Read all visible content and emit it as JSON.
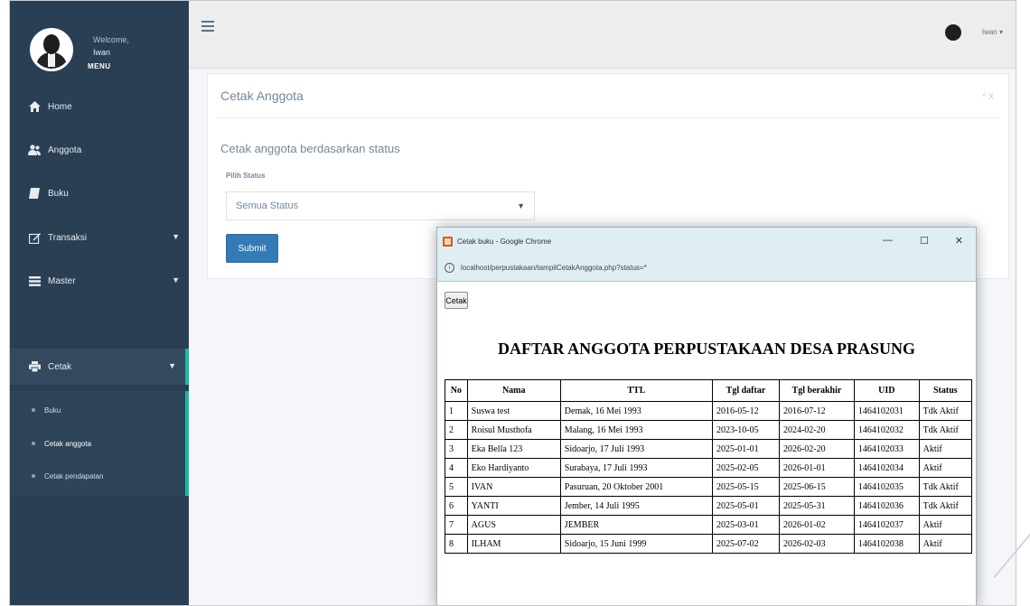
{
  "sidebar": {
    "welcome": "Welcome,",
    "username": "Iwan",
    "menu_title": "MENU",
    "nav": [
      {
        "label": "Home",
        "icon": "home-icon"
      },
      {
        "label": "Anggota",
        "icon": "users-icon"
      },
      {
        "label": "Buku",
        "icon": "book-icon"
      },
      {
        "label": "Transaksi",
        "icon": "edit-icon"
      },
      {
        "label": "Master",
        "icon": "list-icon"
      },
      {
        "label": "Cetak",
        "icon": "print-icon"
      }
    ],
    "sub": [
      "Buku",
      "Cetak anggota",
      "Cetak pendapatan"
    ]
  },
  "topbar": {
    "user": "Iwan"
  },
  "panel": {
    "title": "Cetak Anggota",
    "tools": "^ X",
    "subtitle": "Cetak anggota berdasarkan status",
    "field_label": "Pilih Status",
    "select_value": "Semua Status",
    "submit_label": "Submit"
  },
  "popup": {
    "window_title": "Cetak buku - Google Chrome",
    "url": "localhost/perpustakaan/tampilCetakAnggota.php?status=*",
    "print_button": "Cetak",
    "report_title": "DAFTAR ANGGOTA PERPUSTAKAAN DESA PRASUNG",
    "columns": [
      "No",
      "Nama",
      "TTL",
      "Tgl daftar",
      "Tgl berakhir",
      "UID",
      "Status"
    ],
    "rows": [
      [
        "1",
        "Suswa test",
        "Demak, 16 Mei 1993",
        "2016-05-12",
        "2016-07-12",
        "1464102031",
        "Tdk Aktif"
      ],
      [
        "2",
        "Roisul Musthofa",
        "Malang, 16 Mei 1993",
        "2023-10-05",
        "2024-02-20",
        "1464102032",
        "Tdk Aktif"
      ],
      [
        "3",
        "Eka Bella 123",
        "Sidoarjo, 17 Juli 1993",
        "2025-01-01",
        "2026-02-20",
        "1464102033",
        "Aktif"
      ],
      [
        "4",
        "Eko Hardiyanto",
        "Surabaya, 17 Juli 1993",
        "2025-02-05",
        "2026-01-01",
        "1464102034",
        "Aktif"
      ],
      [
        "5",
        "IVAN",
        "Pasuruan, 20 Oktober 2001",
        "2025-05-15",
        "2025-06-15",
        "1464102035",
        "Tdk Aktif"
      ],
      [
        "6",
        "YANTI",
        "Jember, 14 Juli 1995",
        "2025-05-01",
        "2025-05-31",
        "1464102036",
        "Tdk Aktif"
      ],
      [
        "7",
        "AGUS",
        "JEMBER",
        "2025-03-01",
        "2026-01-02",
        "1464102037",
        "Aktif"
      ],
      [
        "8",
        "ILHAM",
        "Sidoarjo, 15 Juni 1999",
        "2025-07-02",
        "2026-02-03",
        "1464102038",
        "Aktif"
      ]
    ]
  },
  "colors": {
    "sidebar_bg": "#2a3f54",
    "accent": "#1abb9c",
    "button_primary": "#337ab7",
    "popup_chrome": "#deeef2"
  }
}
